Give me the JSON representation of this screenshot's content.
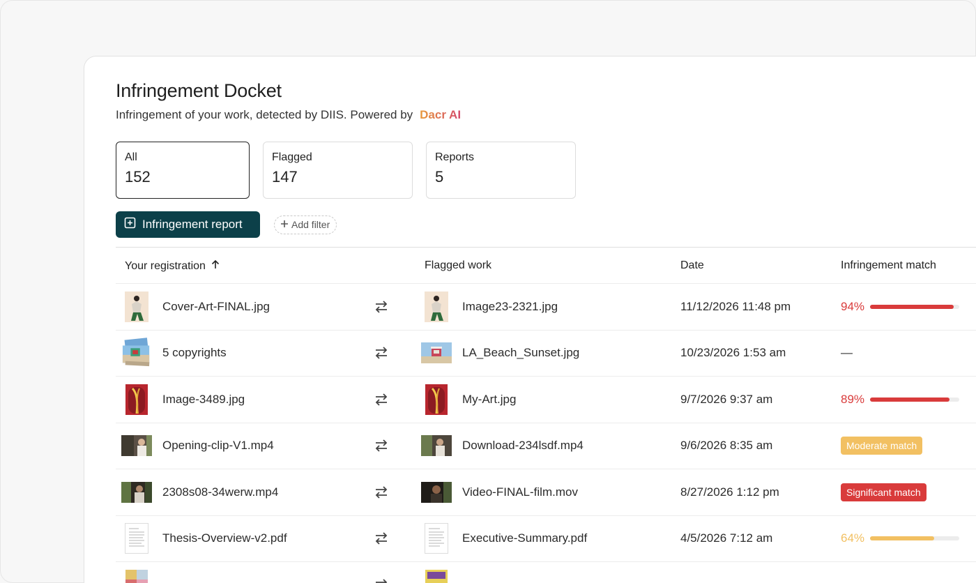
{
  "header": {
    "title": "Infringement Docket",
    "subtitle": "Infringement of your work, detected by DIIS. Powered by",
    "brand": "Dacr AI"
  },
  "stats": [
    {
      "label": "All",
      "value": "152"
    },
    {
      "label": "Flagged",
      "value": "147"
    },
    {
      "label": "Reports",
      "value": "5"
    }
  ],
  "actions": {
    "report_label": "Infringement report",
    "filter_label": "Add filter"
  },
  "table": {
    "columns": {
      "registration": "Your registration",
      "flagged": "Flagged work",
      "date": "Date",
      "match": "Infringement match"
    },
    "rows": [
      {
        "reg": "Cover-Art-FINAL.jpg",
        "flag": "Image23-2321.jpg",
        "date": "11/12/2026 11:48 pm",
        "match_type": "percent",
        "match_text": "94%",
        "match_value": 0.94,
        "color": "#d93b3b"
      },
      {
        "reg": "5 copyrights",
        "flag": "LA_Beach_Sunset.jpg",
        "date": "10/23/2026 1:53 am",
        "match_type": "none",
        "match_text": "—"
      },
      {
        "reg": "Image-3489.jpg",
        "flag": "My-Art.jpg",
        "date": "9/7/2026 9:37 am",
        "match_type": "percent",
        "match_text": "89%",
        "match_value": 0.89,
        "color": "#d93b3b"
      },
      {
        "reg": "Opening-clip-V1.mp4",
        "flag": "Download-234lsdf.mp4",
        "date": "9/6/2026 8:35 am",
        "match_type": "badge",
        "match_text": "Moderate match",
        "color": "#f2c062",
        "text_color": "#ffffff"
      },
      {
        "reg": "2308s08-34werw.mp4",
        "flag": "Video-FINAL-film.mov",
        "date": "8/27/2026 1:12 pm",
        "match_type": "badge",
        "match_text": "Significant match",
        "color": "#d93b3b",
        "text_color": "#ffffff"
      },
      {
        "reg": "Thesis-Overview-v2.pdf",
        "flag": "Executive-Summary.pdf",
        "date": "4/5/2026 7:12 am",
        "match_type": "percent",
        "match_text": "64%",
        "match_value": 0.72,
        "color": "#f2c062"
      }
    ]
  },
  "colors": {
    "accent": "#0c4049",
    "danger": "#d93b3b",
    "warning": "#f2c062"
  }
}
